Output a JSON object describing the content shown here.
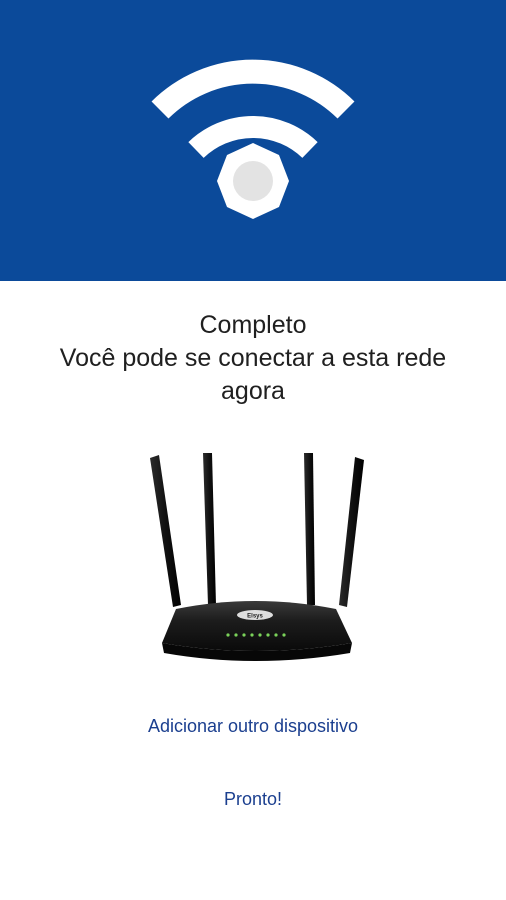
{
  "header": {
    "icon": "wifi-router-icon",
    "background_color": "#0b4a9a"
  },
  "message": {
    "title": "Completo",
    "line1": "Você pode se conectar a esta rede",
    "line2": "agora"
  },
  "illustration": {
    "icon": "router-device-image",
    "brand_text": "Elsys"
  },
  "actions": {
    "add_device_label": "Adicionar outro dispositivo",
    "done_label": "Pronto!",
    "link_color": "#1b3f8f"
  }
}
